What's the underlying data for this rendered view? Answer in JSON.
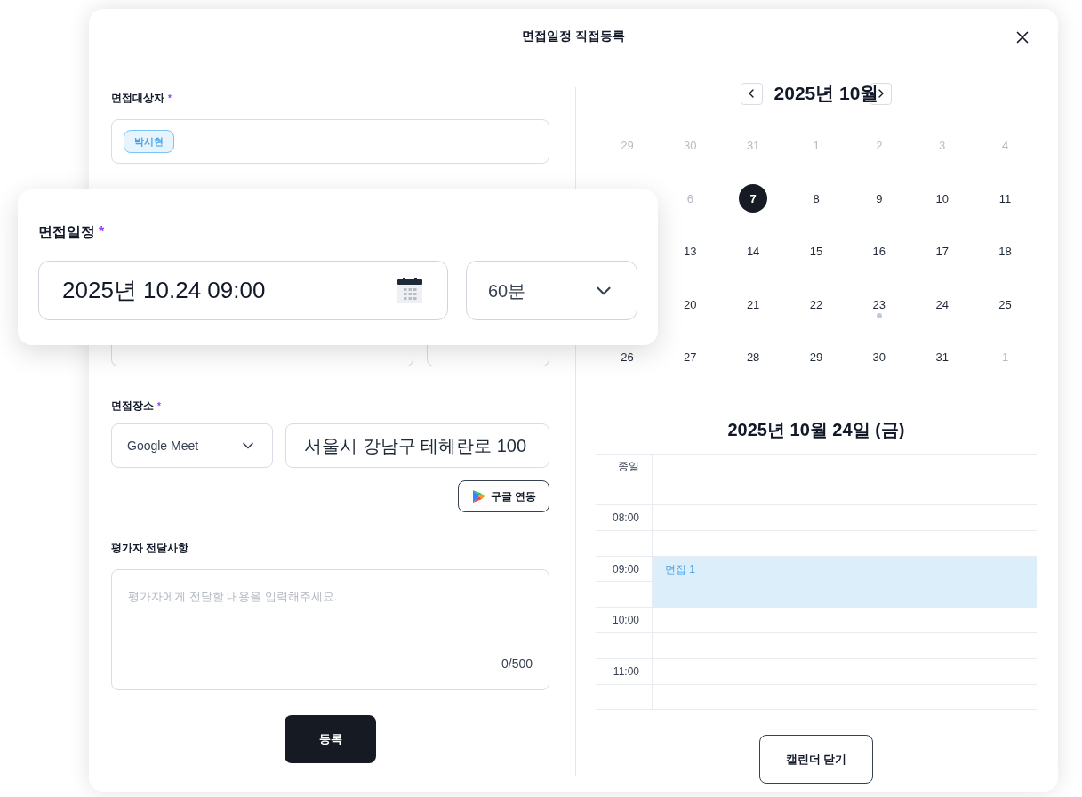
{
  "dialog": {
    "title": "면접일정 직접등록"
  },
  "candidate": {
    "label": "면접대상자",
    "required_mark": "*",
    "chips": [
      "박시현"
    ]
  },
  "schedule_popout": {
    "label": "면접일정",
    "required_mark": "*",
    "datetime": "2025년 10.24 09:00",
    "duration": "60분"
  },
  "location": {
    "label": "면접장소",
    "required_mark": "*",
    "type": "Google Meet",
    "address": "서울시 강남구 테헤란로 100",
    "link_button": "구글 연동"
  },
  "memo": {
    "label": "평가자 전달사항",
    "placeholder": "평가자에게 전달할 내용을 입력해주세요.",
    "counter": "0/500"
  },
  "submit": "등록",
  "calendar": {
    "month": "2025년 10월",
    "weeks": [
      [
        {
          "day": "29",
          "muted": true,
          "selected": false,
          "dot": false
        },
        {
          "day": "30",
          "muted": true,
          "selected": false,
          "dot": false
        },
        {
          "day": "31",
          "muted": true,
          "selected": false,
          "dot": false
        },
        {
          "day": "1",
          "muted": true,
          "selected": false,
          "dot": false
        },
        {
          "day": "2",
          "muted": true,
          "selected": false,
          "dot": false
        },
        {
          "day": "3",
          "muted": true,
          "selected": false,
          "dot": false
        },
        {
          "day": "4",
          "muted": true,
          "selected": false,
          "dot": false
        }
      ],
      [
        {
          "day": "6",
          "muted": true,
          "selected": false,
          "dot": false
        },
        {
          "day": "7",
          "muted": false,
          "selected": true,
          "dot": false
        },
        {
          "day": "8",
          "muted": false,
          "selected": false,
          "dot": false
        },
        {
          "day": "9",
          "muted": false,
          "selected": false,
          "dot": false
        },
        {
          "day": "10",
          "muted": false,
          "selected": false,
          "dot": false
        },
        {
          "day": "11",
          "muted": false,
          "selected": false,
          "dot": false
        }
      ],
      [
        {
          "day": "13",
          "muted": false,
          "selected": false,
          "dot": false
        },
        {
          "day": "14",
          "muted": false,
          "selected": false,
          "dot": false
        },
        {
          "day": "15",
          "muted": false,
          "selected": false,
          "dot": false
        },
        {
          "day": "16",
          "muted": false,
          "selected": false,
          "dot": false
        },
        {
          "day": "17",
          "muted": false,
          "selected": false,
          "dot": false
        },
        {
          "day": "18",
          "muted": false,
          "selected": false,
          "dot": false
        }
      ],
      [
        {
          "day": "20",
          "muted": false,
          "selected": false,
          "dot": false
        },
        {
          "day": "21",
          "muted": false,
          "selected": false,
          "dot": false
        },
        {
          "day": "22",
          "muted": false,
          "selected": false,
          "dot": false
        },
        {
          "day": "23",
          "muted": false,
          "selected": false,
          "dot": true
        },
        {
          "day": "24",
          "muted": false,
          "selected": false,
          "dot": false
        },
        {
          "day": "25",
          "muted": false,
          "selected": false,
          "dot": false
        }
      ],
      [
        {
          "day": "26",
          "muted": false,
          "selected": false,
          "dot": false
        },
        {
          "day": "27",
          "muted": false,
          "selected": false,
          "dot": false
        },
        {
          "day": "28",
          "muted": false,
          "selected": false,
          "dot": false
        },
        {
          "day": "29",
          "muted": false,
          "selected": false,
          "dot": false
        },
        {
          "day": "30",
          "muted": false,
          "selected": false,
          "dot": false
        },
        {
          "day": "31",
          "muted": false,
          "selected": false,
          "dot": false
        },
        {
          "day": "1",
          "muted": true,
          "selected": false,
          "dot": false
        }
      ]
    ]
  },
  "day_view": {
    "title": "2025년 10월 24일 (금)",
    "slots": [
      {
        "label": "종일",
        "booked": false
      },
      {
        "booked": false
      },
      {
        "label": "08:00",
        "booked": false
      },
      {
        "booked": false
      },
      {
        "label": "09:00",
        "booked": true,
        "event": "면접 1"
      },
      {
        "booked": true
      },
      {
        "label": "10:00",
        "booked": false
      },
      {
        "booked": false
      },
      {
        "label": "11:00",
        "booked": false
      },
      {
        "booked": false
      }
    ]
  },
  "close_calendar": "캘린더 닫기"
}
